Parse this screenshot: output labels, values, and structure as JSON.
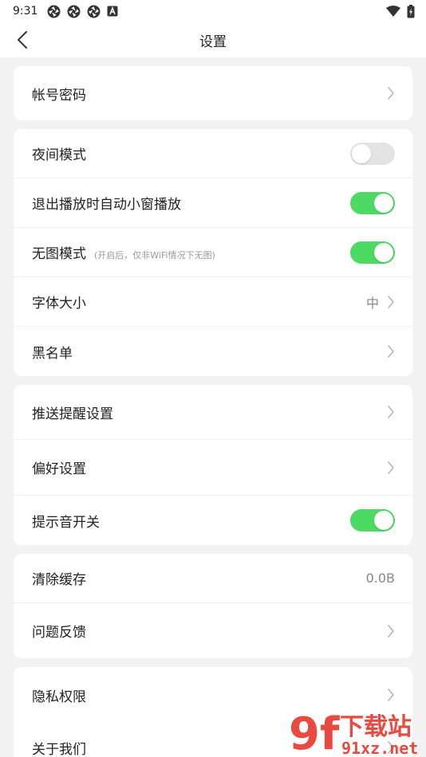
{
  "status_bar": {
    "time": "9:31",
    "icons": [
      "photos-icon",
      "photos-icon",
      "photos-icon",
      "font-a-icon"
    ],
    "right_icons": [
      "wifi-icon",
      "battery-icon"
    ]
  },
  "nav": {
    "title": "设置",
    "back_icon": "chevron-left-icon"
  },
  "sections": [
    {
      "rows": [
        {
          "label": "帐号密码",
          "type": "link"
        }
      ]
    },
    {
      "rows": [
        {
          "label": "夜间模式",
          "type": "toggle",
          "on": false
        },
        {
          "label": "退出播放时自动小窗播放",
          "type": "toggle",
          "on": true
        },
        {
          "label": "无图模式",
          "hint": "(开启后，仅非WiFi情况下无图)",
          "type": "toggle",
          "on": true
        },
        {
          "label": "字体大小",
          "type": "link",
          "value": "中"
        },
        {
          "label": "黑名单",
          "type": "link"
        }
      ]
    },
    {
      "rows": [
        {
          "label": "推送提醒设置",
          "type": "link"
        },
        {
          "label": "偏好设置",
          "type": "link"
        },
        {
          "label": "提示音开关",
          "type": "toggle",
          "on": true
        }
      ]
    },
    {
      "rows": [
        {
          "label": "清除缓存",
          "type": "value",
          "value": "0.0B"
        },
        {
          "label": "问题反馈",
          "type": "link"
        }
      ]
    },
    {
      "rows": [
        {
          "label": "隐私权限",
          "type": "link"
        },
        {
          "label": "关于我们",
          "type": "link"
        }
      ]
    }
  ],
  "watermark": {
    "logo_text": "9f",
    "title": "下载站",
    "url": "91xz.net"
  },
  "colors": {
    "toggle_on": "#4cd964",
    "toggle_off": "#e3e3e3",
    "background": "#f2f2f2",
    "watermark_red": "#e8362b"
  }
}
